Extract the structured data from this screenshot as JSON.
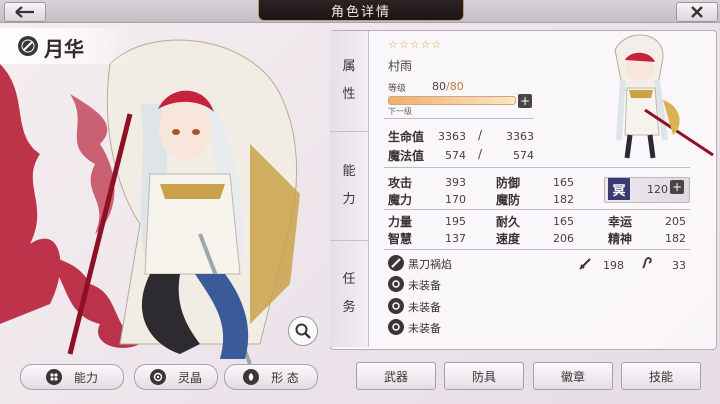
{
  "header": {
    "title": "角色详情"
  },
  "character": {
    "name": "月华"
  },
  "side_tabs": {
    "attribute": [
      "属",
      "性"
    ],
    "ability": [
      "能",
      "力"
    ],
    "task": [
      "任",
      "务"
    ]
  },
  "profile": {
    "stars": "☆☆☆☆☆",
    "weapon_type": "村雨",
    "level_label": "等级",
    "level_current": "80",
    "level_separator": "/",
    "level_max": "80",
    "next_level_label": "下一级"
  },
  "vitals": {
    "hp_label": "生命值",
    "hp_current": "3363",
    "hp_max": "3363",
    "mp_label": "魔法值",
    "mp_current": "574",
    "mp_max": "574"
  },
  "stats": {
    "atk_label": "攻击",
    "atk": "393",
    "def_label": "防御",
    "def": "165",
    "mag_label": "魔力",
    "mag": "170",
    "mdef_label": "魔防",
    "mdef": "182",
    "str_label": "力量",
    "str": "195",
    "end_label": "耐久",
    "end": "165",
    "luck_label": "幸运",
    "luck": "205",
    "int_label": "智慧",
    "int": "137",
    "spd_label": "速度",
    "spd": "206",
    "spirit_label": "精神",
    "spirit": "182",
    "prayer_glyph": "冥",
    "prayer_value": "120"
  },
  "equipment": {
    "weapon_name": "黑刀祸焰",
    "weapon_atk": "198",
    "weapon_hit": "33",
    "slot1": "未装备",
    "slot2": "未装备",
    "slot3": "未装备"
  },
  "bottom_left": {
    "ability": "能力",
    "crystal": "灵晶",
    "form": "形 态"
  },
  "bottom_tabs": {
    "weapon": "武器",
    "armor": "防具",
    "badge": "徽章",
    "skill": "技能"
  },
  "icons": [
    "back-arrow-icon",
    "close-icon",
    "sword-emblem-icon",
    "magnify-icon",
    "plus-icon",
    "sword-icon",
    "hit-icon",
    "gear-slot-icon"
  ],
  "colors": {
    "accent_red": "#c0283c",
    "panel_title_bg": "#1c1415",
    "level_bar": "#f0b06a"
  }
}
